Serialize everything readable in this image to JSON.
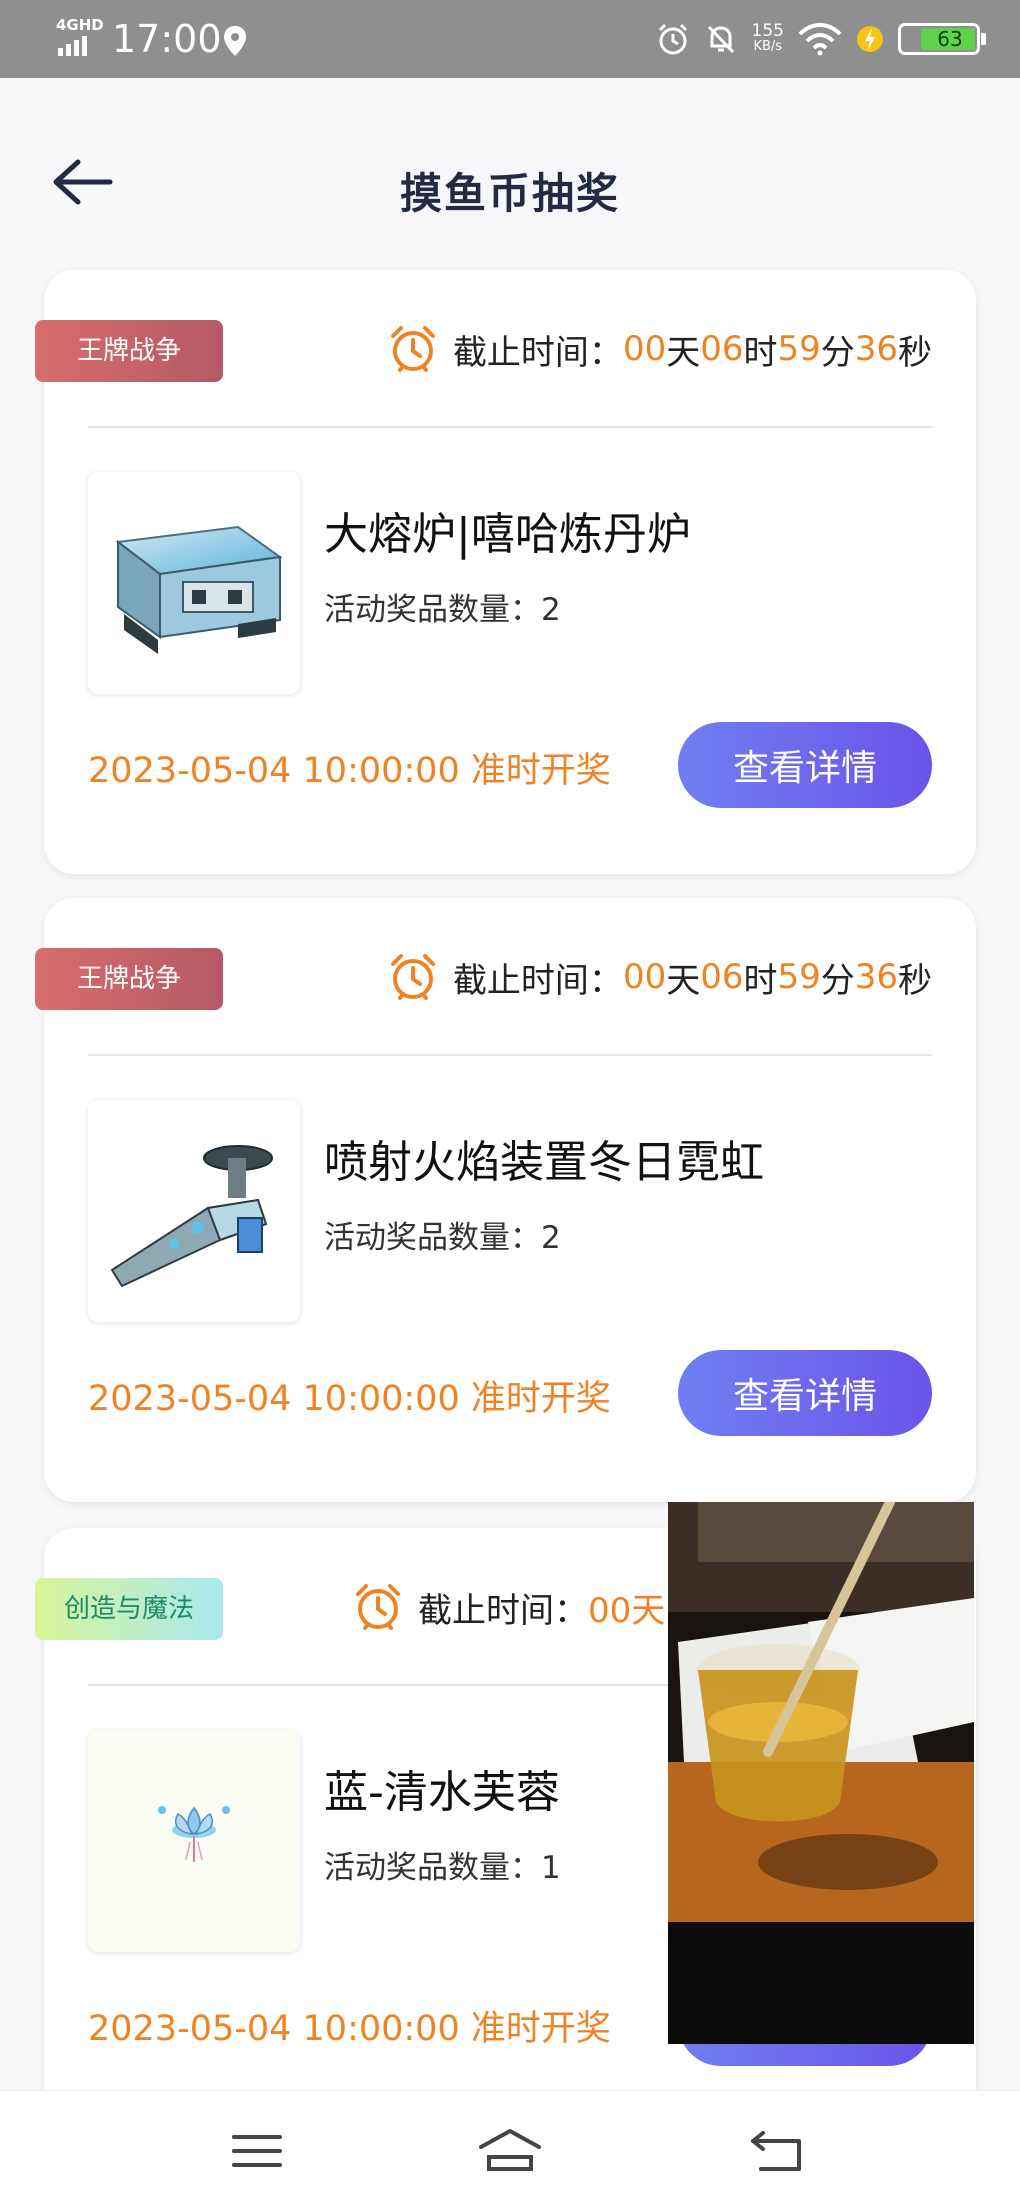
{
  "status_bar": {
    "network": "4GHD",
    "time": "17:00",
    "speed_value": "155",
    "speed_unit": "KB/s",
    "battery": "63"
  },
  "header": {
    "title": "摸鱼币抽奖",
    "back_icon": "arrow-left-icon"
  },
  "cards": [
    {
      "tag": "王牌战争",
      "tag_color": "#c96165",
      "deadline_label": "截止时间：",
      "countdown": {
        "days": "00",
        "day_unit": "天",
        "hours": "06",
        "hour_unit": "时",
        "minutes": "59",
        "minute_unit": "分",
        "seconds": "36",
        "second_unit": "秒"
      },
      "prize_name": "大熔炉|嘻哈炼丹炉",
      "prize_count": "活动奖品数量：2",
      "draw_time": "2023-05-04 10:00:00 准时开奖",
      "button": "查看详情"
    },
    {
      "tag": "王牌战争",
      "tag_color": "#c96165",
      "deadline_label": "截止时间：",
      "countdown": {
        "days": "00",
        "day_unit": "天",
        "hours": "06",
        "hour_unit": "时",
        "minutes": "59",
        "minute_unit": "分",
        "seconds": "36",
        "second_unit": "秒"
      },
      "prize_name": "喷射火焰装置冬日霓虹",
      "prize_count": "活动奖品数量：2",
      "draw_time": "2023-05-04 10:00:00 准时开奖",
      "button": "查看详情"
    },
    {
      "tag": "创造与魔法",
      "tag_color": "#b8ecc0",
      "deadline_label": "截止时间：",
      "countdown_visible": "00天",
      "prize_name": "蓝-清水芙蓉",
      "prize_count": "活动奖品数量：1",
      "draw_time": "2023-05-04 10:00:00 准时开奖"
    }
  ],
  "accent_color": "#ef8324",
  "button_color": "#6b6cf0",
  "nav_bar": {
    "icons": [
      "menu-icon",
      "home-icon",
      "back-icon"
    ]
  }
}
